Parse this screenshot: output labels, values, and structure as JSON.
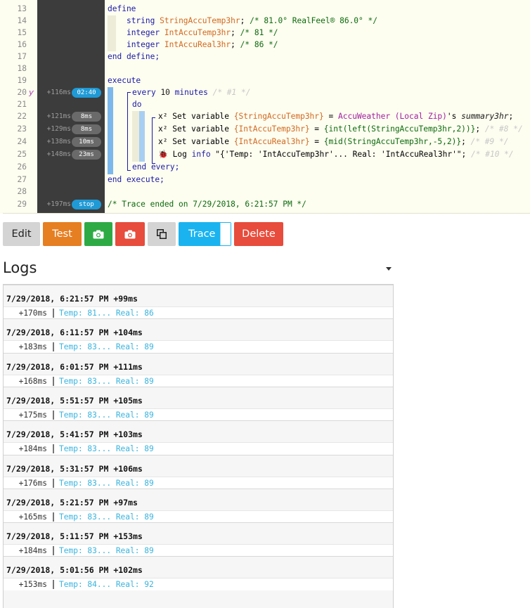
{
  "code": {
    "lines": [
      {
        "n": "13",
        "time": "",
        "badge": "",
        "badge_color": "",
        "marker": "",
        "text": "define"
      },
      {
        "n": "14",
        "time": "",
        "badge": "",
        "badge_color": "",
        "marker": "",
        "text": "    string StringAccuTemp3hr; /* 81.0° RealFeel® 86.0° */"
      },
      {
        "n": "15",
        "time": "",
        "badge": "",
        "badge_color": "",
        "marker": "",
        "text": "    integer IntAccuTemp3hr; /* 81 */"
      },
      {
        "n": "16",
        "time": "",
        "badge": "",
        "badge_color": "",
        "marker": "",
        "text": "    integer IntAccuReal3hr; /* 86 */"
      },
      {
        "n": "17",
        "time": "",
        "badge": "",
        "badge_color": "",
        "marker": "",
        "text": "end define;"
      },
      {
        "n": "18",
        "time": "",
        "badge": "",
        "badge_color": "",
        "marker": "",
        "text": ""
      },
      {
        "n": "19",
        "time": "",
        "badge": "",
        "badge_color": "",
        "marker": "",
        "text": "execute"
      },
      {
        "n": "20",
        "time": "+116ms",
        "badge": "02:40",
        "badge_color": "blue",
        "marker": "ƴ",
        "text": "every 10 minutes /* #1 */"
      },
      {
        "n": "21",
        "time": "",
        "badge": "",
        "badge_color": "",
        "marker": "",
        "text": "do"
      },
      {
        "n": "22",
        "time": "+121ms",
        "badge": "8ms",
        "badge_color": "gray",
        "marker": "",
        "text": "x² Set variable {StringAccuTemp3hr} = AccuWeather (Local Zip)'s summary3hr;"
      },
      {
        "n": "23",
        "time": "+129ms",
        "badge": "8ms",
        "badge_color": "gray",
        "marker": "",
        "text": "x² Set variable {IntAccuTemp3hr} = {int(left(StringAccuTemp3hr,2))}; /* #8 */"
      },
      {
        "n": "24",
        "time": "+138ms",
        "badge": "10ms",
        "badge_color": "gray",
        "marker": "",
        "text": "x² Set variable {IntAccuReal3hr} = {mid(StringAccuTemp3hr,-5,2)}; /* #9 */"
      },
      {
        "n": "25",
        "time": "+148ms",
        "badge": "23ms",
        "badge_color": "gray",
        "marker": "",
        "text": "🐞 Log info \"{'Temp: 'IntAccuTemp3hr'... Real: 'IntAccuReal3hr'\"; /* #10 */"
      },
      {
        "n": "26",
        "time": "",
        "badge": "",
        "badge_color": "",
        "marker": "",
        "text": "end every;"
      },
      {
        "n": "27",
        "time": "",
        "badge": "",
        "badge_color": "",
        "marker": "",
        "text": "end execute;"
      },
      {
        "n": "28",
        "time": "",
        "badge": "",
        "badge_color": "",
        "marker": "",
        "text": ""
      },
      {
        "n": "29",
        "time": "+197ms",
        "badge": "stop",
        "badge_color": "blue",
        "marker": "",
        "text": "/* Trace ended on 7/29/2018, 6:21:57 PM */"
      }
    ]
  },
  "toolbar": {
    "edit_label": "Edit",
    "test_label": "Test",
    "trace_label": "Trace",
    "delete_label": "Delete",
    "camera_icon": "camera-icon",
    "copy_icon": "copy-icon"
  },
  "logs": {
    "title": "Logs",
    "entries": [
      {
        "header": "7/29/2018, 6:21:57 PM +99ms",
        "ms": "+170ms",
        "message": "Temp: 81... Real: 86"
      },
      {
        "header": "7/29/2018, 6:11:57 PM +104ms",
        "ms": "+183ms",
        "message": "Temp: 83... Real: 89"
      },
      {
        "header": "7/29/2018, 6:01:57 PM +111ms",
        "ms": "+168ms",
        "message": "Temp: 83... Real: 89"
      },
      {
        "header": "7/29/2018, 5:51:57 PM +105ms",
        "ms": "+175ms",
        "message": "Temp: 83... Real: 89"
      },
      {
        "header": "7/29/2018, 5:41:57 PM +103ms",
        "ms": "+184ms",
        "message": "Temp: 83... Real: 89"
      },
      {
        "header": "7/29/2018, 5:31:57 PM +106ms",
        "ms": "+176ms",
        "message": "Temp: 83... Real: 89"
      },
      {
        "header": "7/29/2018, 5:21:57 PM +97ms",
        "ms": "+165ms",
        "message": "Temp: 83... Real: 89"
      },
      {
        "header": "7/29/2018, 5:11:57 PM +153ms",
        "ms": "+184ms",
        "message": "Temp: 83... Real: 89"
      },
      {
        "header": "7/29/2018, 5:01:56 PM +102ms",
        "ms": "+153ms",
        "message": "Temp: 84... Real: 92"
      }
    ]
  }
}
